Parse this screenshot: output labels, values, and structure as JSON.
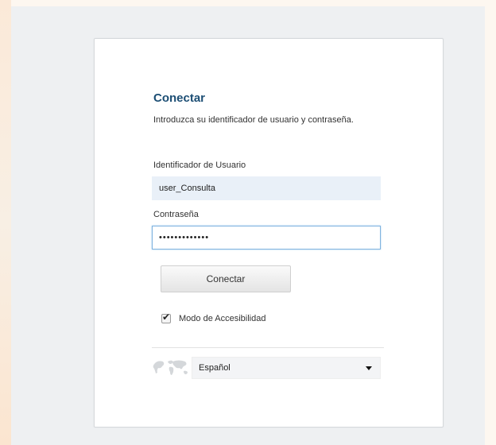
{
  "login": {
    "title": "Conectar",
    "intro": "Introduzca su identificador de usuario y contraseña.",
    "user_label": "Identificador de Usuario",
    "user_value": "user_Consulta",
    "password_label": "Contraseña",
    "password_mask": "•••••••••••••",
    "connect_button": "Conectar",
    "accessibility_label": "Modo de Accesibilidad",
    "accessibility_checked": true,
    "language_selected": "Español"
  },
  "colors": {
    "title": "#1c4e74",
    "page_bg": "#eef0f2",
    "input_fill": "#e9f0f8",
    "focus_border": "#7fb3df"
  },
  "icons": {
    "language": "world-map-icon",
    "dropdown": "dropdown-arrow-icon",
    "checkbox": "checkmark-icon"
  }
}
